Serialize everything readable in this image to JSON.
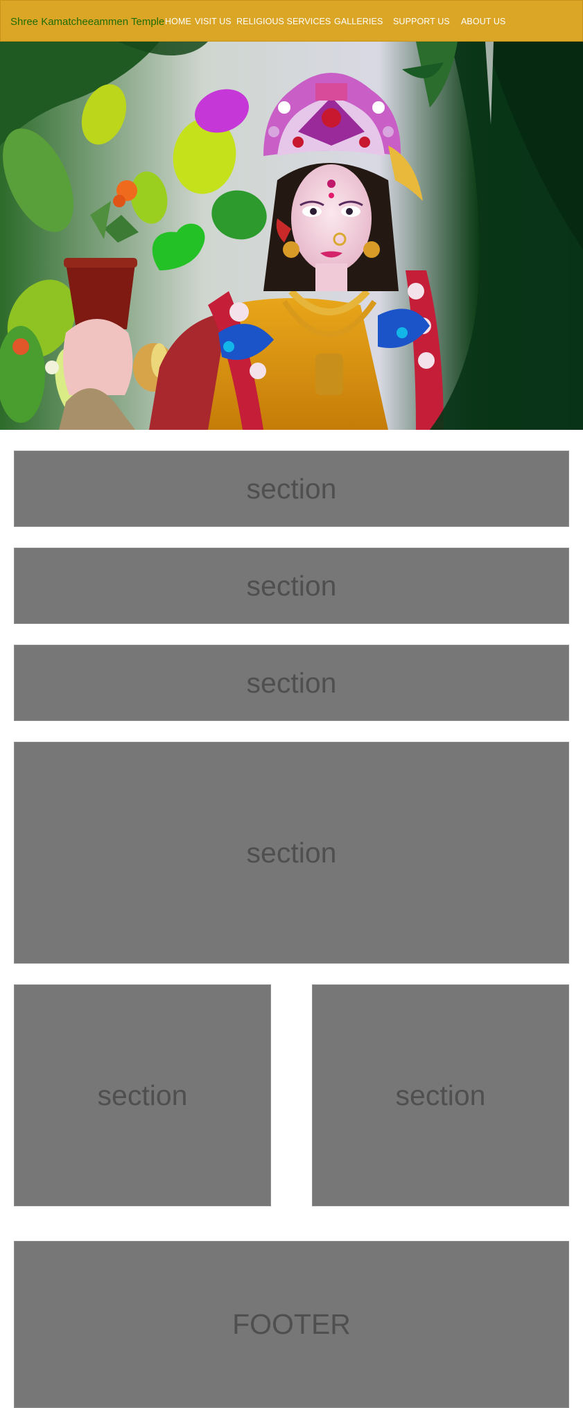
{
  "header": {
    "brand": "Shree Kamatcheeammen Temple",
    "nav": [
      {
        "label": "HOME"
      },
      {
        "label": "VISIT US"
      },
      {
        "label": "RELIGIOUS SERVICES"
      },
      {
        "label": "GALLERIES"
      },
      {
        "label": "SUPPORT US"
      },
      {
        "label": "ABOUT US"
      }
    ]
  },
  "hero": {
    "icon": "goddess-statue-photo"
  },
  "sections": [
    {
      "label": "section"
    },
    {
      "label": "section"
    },
    {
      "label": "section"
    },
    {
      "label": "section"
    },
    {
      "label": "section"
    },
    {
      "label": "section"
    }
  ],
  "footer": {
    "label": "FOOTER"
  },
  "colors": {
    "header_bg": "#dba526",
    "brand_text": "#1f6d00",
    "nav_text": "#ffffff",
    "placeholder_bg": "#777777",
    "placeholder_text": "#4f4f4f"
  }
}
